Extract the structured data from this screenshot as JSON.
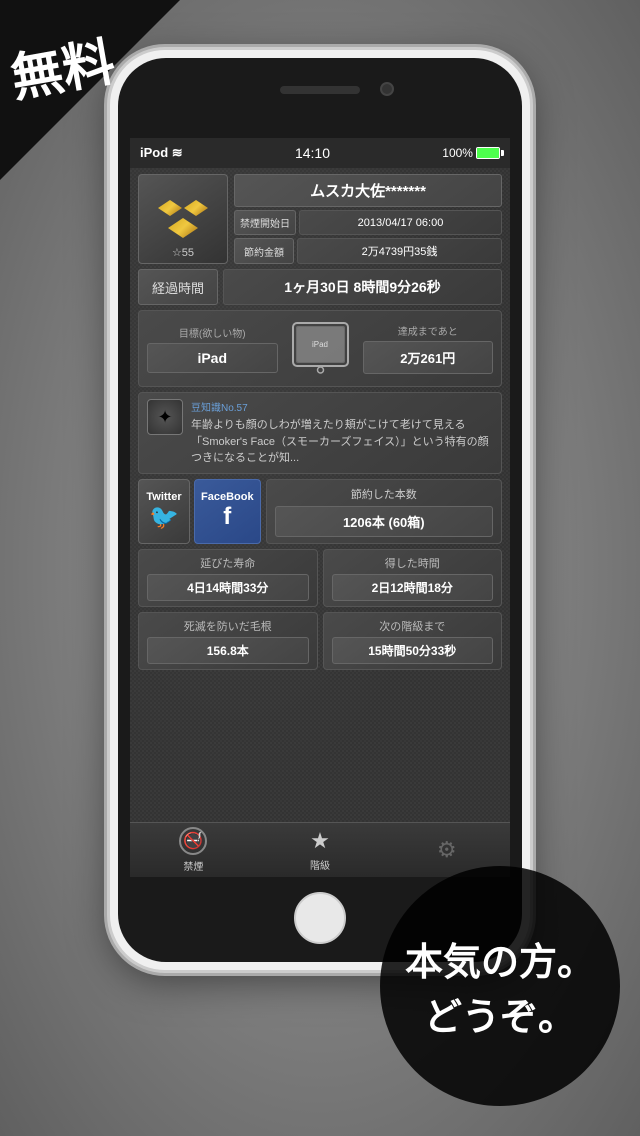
{
  "banner": {
    "free_text": "無料"
  },
  "bottom_cta": {
    "line1": "本気の方。",
    "line2": "どうぞ。"
  },
  "status_bar": {
    "carrier": "iPod",
    "time": "14:10",
    "battery": "100%"
  },
  "user": {
    "name": "ムスカ大佐*******",
    "start_date_label": "禁煙開始日",
    "start_date": "2013/04/17 06:00",
    "savings_label": "節約金額",
    "savings": "2万4739円35銭",
    "stars": "☆55"
  },
  "elapsed": {
    "label": "経過時間",
    "value": "1ヶ月30日 8時間9分26秒"
  },
  "goal": {
    "target_label": "目標(欲しい物)",
    "target": "iPad",
    "remaining_label": "達成まであと",
    "remaining": "2万261円"
  },
  "fact": {
    "label": "豆知識No.57",
    "text": "年齢よりも顔のしわが増えたり頬がこけて老けて見える「Smoker's Face（スモーカーズフェイス）」という特有の顔つきになることが知..."
  },
  "social": {
    "twitter_label": "Twitter",
    "facebook_label": "FaceBook",
    "saved_label": "節約した本数",
    "saved_value": "1206本 (60箱)"
  },
  "stats": [
    {
      "label": "延びた寿命",
      "value": "4日14時間33分"
    },
    {
      "label": "得した時間",
      "value": "2日12時間18分"
    },
    {
      "label": "死滅を防いだ毛根",
      "value": "156.8本"
    },
    {
      "label": "次の階級まで",
      "value": "15時間50分33秒"
    }
  ],
  "tabs": [
    {
      "label": "禁煙",
      "icon": "🚭",
      "type": "no-smoking"
    },
    {
      "label": "階級",
      "icon": "★",
      "type": "star"
    },
    {
      "label": "",
      "icon": "⚙",
      "type": "gear"
    }
  ]
}
